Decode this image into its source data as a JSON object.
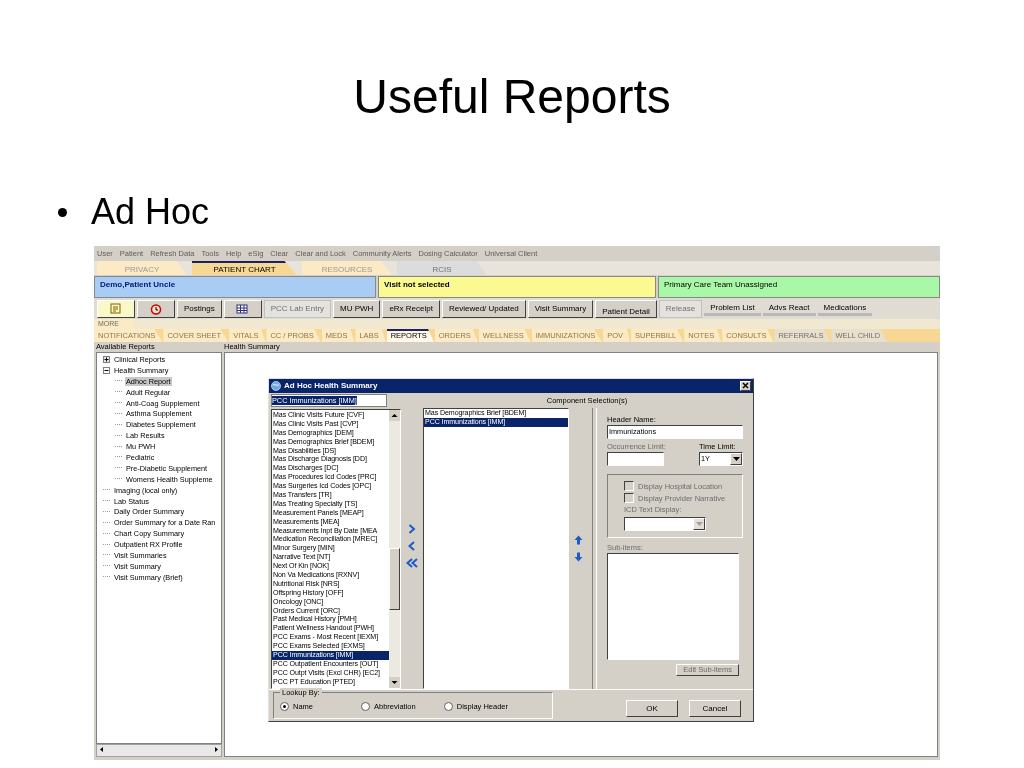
{
  "slide": {
    "title": "Useful Reports",
    "bullets": [
      "Ad Hoc"
    ]
  },
  "app": {
    "menu": [
      "User",
      "Patient",
      "Refresh Data",
      "Tools",
      "Help",
      "eSig",
      "Clear",
      "Clear and Lock",
      "Community Alerts",
      "Dosing Calculator",
      "Universal Client"
    ],
    "top_tabs": [
      {
        "label": "PRIVACY",
        "selected": false,
        "disabled": false
      },
      {
        "label": "PATIENT CHART",
        "selected": true,
        "disabled": false
      },
      {
        "label": "RESOURCES",
        "selected": false,
        "disabled": false
      },
      {
        "label": "RCIS",
        "selected": false,
        "disabled": true
      }
    ],
    "banner": [
      {
        "kind": "patient",
        "text": "Demo,Patient Uncle"
      },
      {
        "kind": "visit",
        "text": "Visit not selected"
      },
      {
        "kind": "team",
        "text": "Primary Care Team Unassigned"
      }
    ],
    "toolbar": [
      {
        "kind": "icon",
        "disabled": false
      },
      {
        "kind": "icon",
        "disabled": false
      },
      {
        "kind": "button",
        "label": "Postings",
        "disabled": false
      },
      {
        "kind": "icon",
        "disabled": false
      },
      {
        "kind": "button",
        "label": "PCC Lab Entry",
        "disabled": true
      },
      {
        "kind": "button",
        "label": "MU PWH",
        "disabled": false
      },
      {
        "kind": "button",
        "label": "eRx Receipt",
        "disabled": false
      },
      {
        "kind": "button",
        "label": "Reviewed/ Updated",
        "disabled": false
      },
      {
        "kind": "button",
        "label": "Visit Summary",
        "disabled": false
      },
      {
        "kind": "detail",
        "label": "Patient Detail",
        "disabled": false
      },
      {
        "kind": "button",
        "label": "Release",
        "disabled": true
      },
      {
        "kind": "flat",
        "label": "Problem List",
        "disabled": false
      },
      {
        "kind": "flat",
        "label": "Advs React",
        "disabled": false
      },
      {
        "kind": "flat",
        "label": "Medications",
        "disabled": false
      }
    ],
    "more_label": "MORE",
    "chart_tabs": [
      {
        "label": "NOTIFICATIONS",
        "selected": false,
        "disabled": false
      },
      {
        "label": "COVER SHEET",
        "selected": false,
        "disabled": false
      },
      {
        "label": "VITALS",
        "selected": false,
        "disabled": false
      },
      {
        "label": "CC / PROBS",
        "selected": false,
        "disabled": false
      },
      {
        "label": "MEDS",
        "selected": false,
        "disabled": false
      },
      {
        "label": "LABS",
        "selected": false,
        "disabled": false
      },
      {
        "label": "REPORTS",
        "selected": true,
        "disabled": false
      },
      {
        "label": "ORDERS",
        "selected": false,
        "disabled": false
      },
      {
        "label": "WELLNESS",
        "selected": false,
        "disabled": false
      },
      {
        "label": "IMMUNIZATIONS",
        "selected": false,
        "disabled": false
      },
      {
        "label": "POV",
        "selected": false,
        "disabled": false
      },
      {
        "label": "SUPERBILL",
        "selected": false,
        "disabled": false
      },
      {
        "label": "NOTES",
        "selected": false,
        "disabled": false
      },
      {
        "label": "CONSULTS",
        "selected": false,
        "disabled": false
      },
      {
        "label": "REFERRALS",
        "selected": false,
        "disabled": true
      },
      {
        "label": "WELL CHILD",
        "selected": false,
        "disabled": true
      }
    ],
    "reports_panel": {
      "title": "Available Reports",
      "tree": [
        {
          "label": "Clinical Reports",
          "expanded": false,
          "selected": false
        },
        {
          "label": "Health Summary",
          "expanded": true,
          "selected": false,
          "children": [
            {
              "label": "Adhoc Report",
              "selected": true
            },
            {
              "label": "Adult Regular",
              "selected": false
            },
            {
              "label": "Anti-Coag Supplement",
              "selected": false
            },
            {
              "label": "Asthma Supplement",
              "selected": false
            },
            {
              "label": "Diabetes Supplement",
              "selected": false
            },
            {
              "label": "Lab Results",
              "selected": false
            },
            {
              "label": "Mu PWH",
              "selected": false
            },
            {
              "label": "Pediatric",
              "selected": false
            },
            {
              "label": "Pre-Diabetic Supplement",
              "selected": false
            },
            {
              "label": "Womens Health Suppleme",
              "selected": false
            }
          ]
        },
        {
          "label": "Imaging (local only)",
          "selected": false
        },
        {
          "label": "Lab Status",
          "selected": false
        },
        {
          "label": "Daily Order Summary",
          "selected": false
        },
        {
          "label": "Order Summary for a Date Ran",
          "selected": false
        },
        {
          "label": "Chart Copy Summary",
          "selected": false
        },
        {
          "label": "Outpatient RX Profile",
          "selected": false
        },
        {
          "label": "Visit Summaries",
          "selected": false
        },
        {
          "label": "Visit Summary",
          "selected": false
        },
        {
          "label": "Visit Summary (Brief)",
          "selected": false
        }
      ]
    },
    "content_title": "Health Summary",
    "dialog": {
      "title": "Ad Hoc Health Summary",
      "search_value": "PCC Immunizations [IMM]",
      "components": [
        {
          "label": "Mas Clinic Visits Future [CVF]",
          "selected": false
        },
        {
          "label": "Mas Clinic Visits Past [CVP]",
          "selected": false
        },
        {
          "label": "Mas Demographics [DEM]",
          "selected": false
        },
        {
          "label": "Mas Demographics Brief [BDEM]",
          "selected": false
        },
        {
          "label": "Mas Disabilities [DS]",
          "selected": false
        },
        {
          "label": "Mas Discharge Diagnosis [DD]",
          "selected": false
        },
        {
          "label": "Mas Discharges [DC]",
          "selected": false
        },
        {
          "label": "Mas Procedures Icd Codes [PRC]",
          "selected": false
        },
        {
          "label": "Mas Surgeries Icd Codes [OPC]",
          "selected": false
        },
        {
          "label": "Mas Transfers [TR]",
          "selected": false
        },
        {
          "label": "Mas Treating Specialty [TS]",
          "selected": false
        },
        {
          "label": "Measurement Panels [MEAP]",
          "selected": false
        },
        {
          "label": "Measurements [MEA]",
          "selected": false
        },
        {
          "label": "Measurements Inpt By Date [MEA",
          "selected": false
        },
        {
          "label": "Medication Reconciliation [MREC]",
          "selected": false
        },
        {
          "label": "Minor Surgery [MIN]",
          "selected": false
        },
        {
          "label": "Narrative Text [NT]",
          "selected": false
        },
        {
          "label": "Next Of Kin [NOK]",
          "selected": false
        },
        {
          "label": "Non Va Medications [RXNV]",
          "selected": false
        },
        {
          "label": "Nutritional Risk [NRS]",
          "selected": false
        },
        {
          "label": "Offspring History [OFF]",
          "selected": false
        },
        {
          "label": "Oncology [ONC]",
          "selected": false
        },
        {
          "label": "Orders Current [ORC]",
          "selected": false
        },
        {
          "label": "Past Medical History [PMH]",
          "selected": false
        },
        {
          "label": "Patient Wellness Handout [PWH]",
          "selected": false
        },
        {
          "label": "PCC Exams - Most Recent [IEXM]",
          "selected": false
        },
        {
          "label": "PCC Exams Selected [EXMS]",
          "selected": false
        },
        {
          "label": "PCC Immunizations [IMM]",
          "selected": true
        },
        {
          "label": "PCC Outpatient Encounters [OUT]",
          "selected": false
        },
        {
          "label": "PCC Outpt Visits (Excl CHR) [EC2]",
          "selected": false
        },
        {
          "label": "PCC PT Education [PTED]",
          "selected": false
        }
      ],
      "selection_title": "Component Selection(s)",
      "selected_components": [
        {
          "label": "Mas Demographics Brief [BDEM]",
          "selected": false
        },
        {
          "label": "PCC Immunizations [IMM]",
          "selected": true
        }
      ],
      "header_name": {
        "label": "Header Name:",
        "value": "Immunizations"
      },
      "occurrence_limit": {
        "label": "Occurrence Limit:",
        "disabled": true
      },
      "time_limit": {
        "label": "Time Limit:",
        "value": "1Y"
      },
      "options": [
        {
          "label": "Display Hospital Location",
          "checked": false,
          "disabled": true
        },
        {
          "label": "Display Provider Narrative",
          "checked": false,
          "disabled": true
        }
      ],
      "icd_label": {
        "label": "ICD Text Display:",
        "disabled": true
      },
      "subitems_label": {
        "label": "Sub-items:",
        "disabled": true
      },
      "edit_button": {
        "label": "Edit Sub-items",
        "disabled": true
      },
      "lookup": {
        "label": "Lookup By:",
        "options": [
          {
            "label": "Name",
            "selected": true
          },
          {
            "label": "Abbreviation",
            "selected": false
          },
          {
            "label": "Display Header",
            "selected": false
          }
        ]
      },
      "ok": "OK",
      "cancel": "Cancel"
    }
  }
}
